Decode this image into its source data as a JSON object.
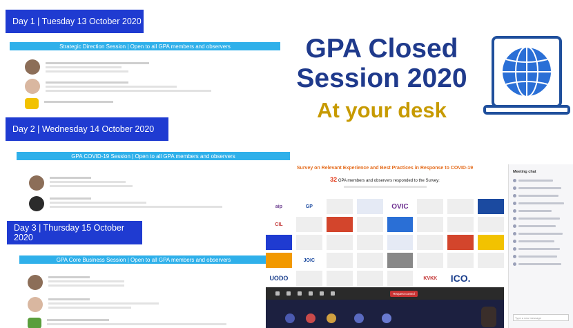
{
  "days": [
    {
      "label": "Day 1 | Tuesday 13 October 2020"
    },
    {
      "label": "Day 2 | Wednesday 14 October 2020"
    },
    {
      "label": "Day 3 | Thursday 15 October 2020"
    }
  ],
  "sessions": [
    {
      "label": "Strategic Direction Session  |  Open to all GPA members and observers"
    },
    {
      "label": "GPA COVID-19 Session  |  Open to all GPA members and observers"
    },
    {
      "label": "GPA Core Business Session | Open to all GPA members and observers"
    }
  ],
  "title": {
    "line1": "GPA Closed",
    "line2": "Session 2020",
    "tagline": "At your desk"
  },
  "survey": {
    "title": "Survey on Relevant Experience and Best Practices in Response to COVID-19",
    "count": "32",
    "count_text": "GPA members and observers responded to the Survey:"
  },
  "logos": [
    "aip",
    "GP",
    "OVIC",
    "CIL",
    "JOIC",
    "UODO",
    "ICO.",
    "KVKK"
  ],
  "callbar": {
    "end_label": "Request control"
  },
  "chat": {
    "title": "Meeting chat",
    "input_placeholder": "Type a new message"
  },
  "colors": {
    "day_bar": "#1f3bd1",
    "session_bar": "#2fb0ea",
    "title_blue": "#1f3a8c",
    "title_gold": "#c79a00"
  }
}
